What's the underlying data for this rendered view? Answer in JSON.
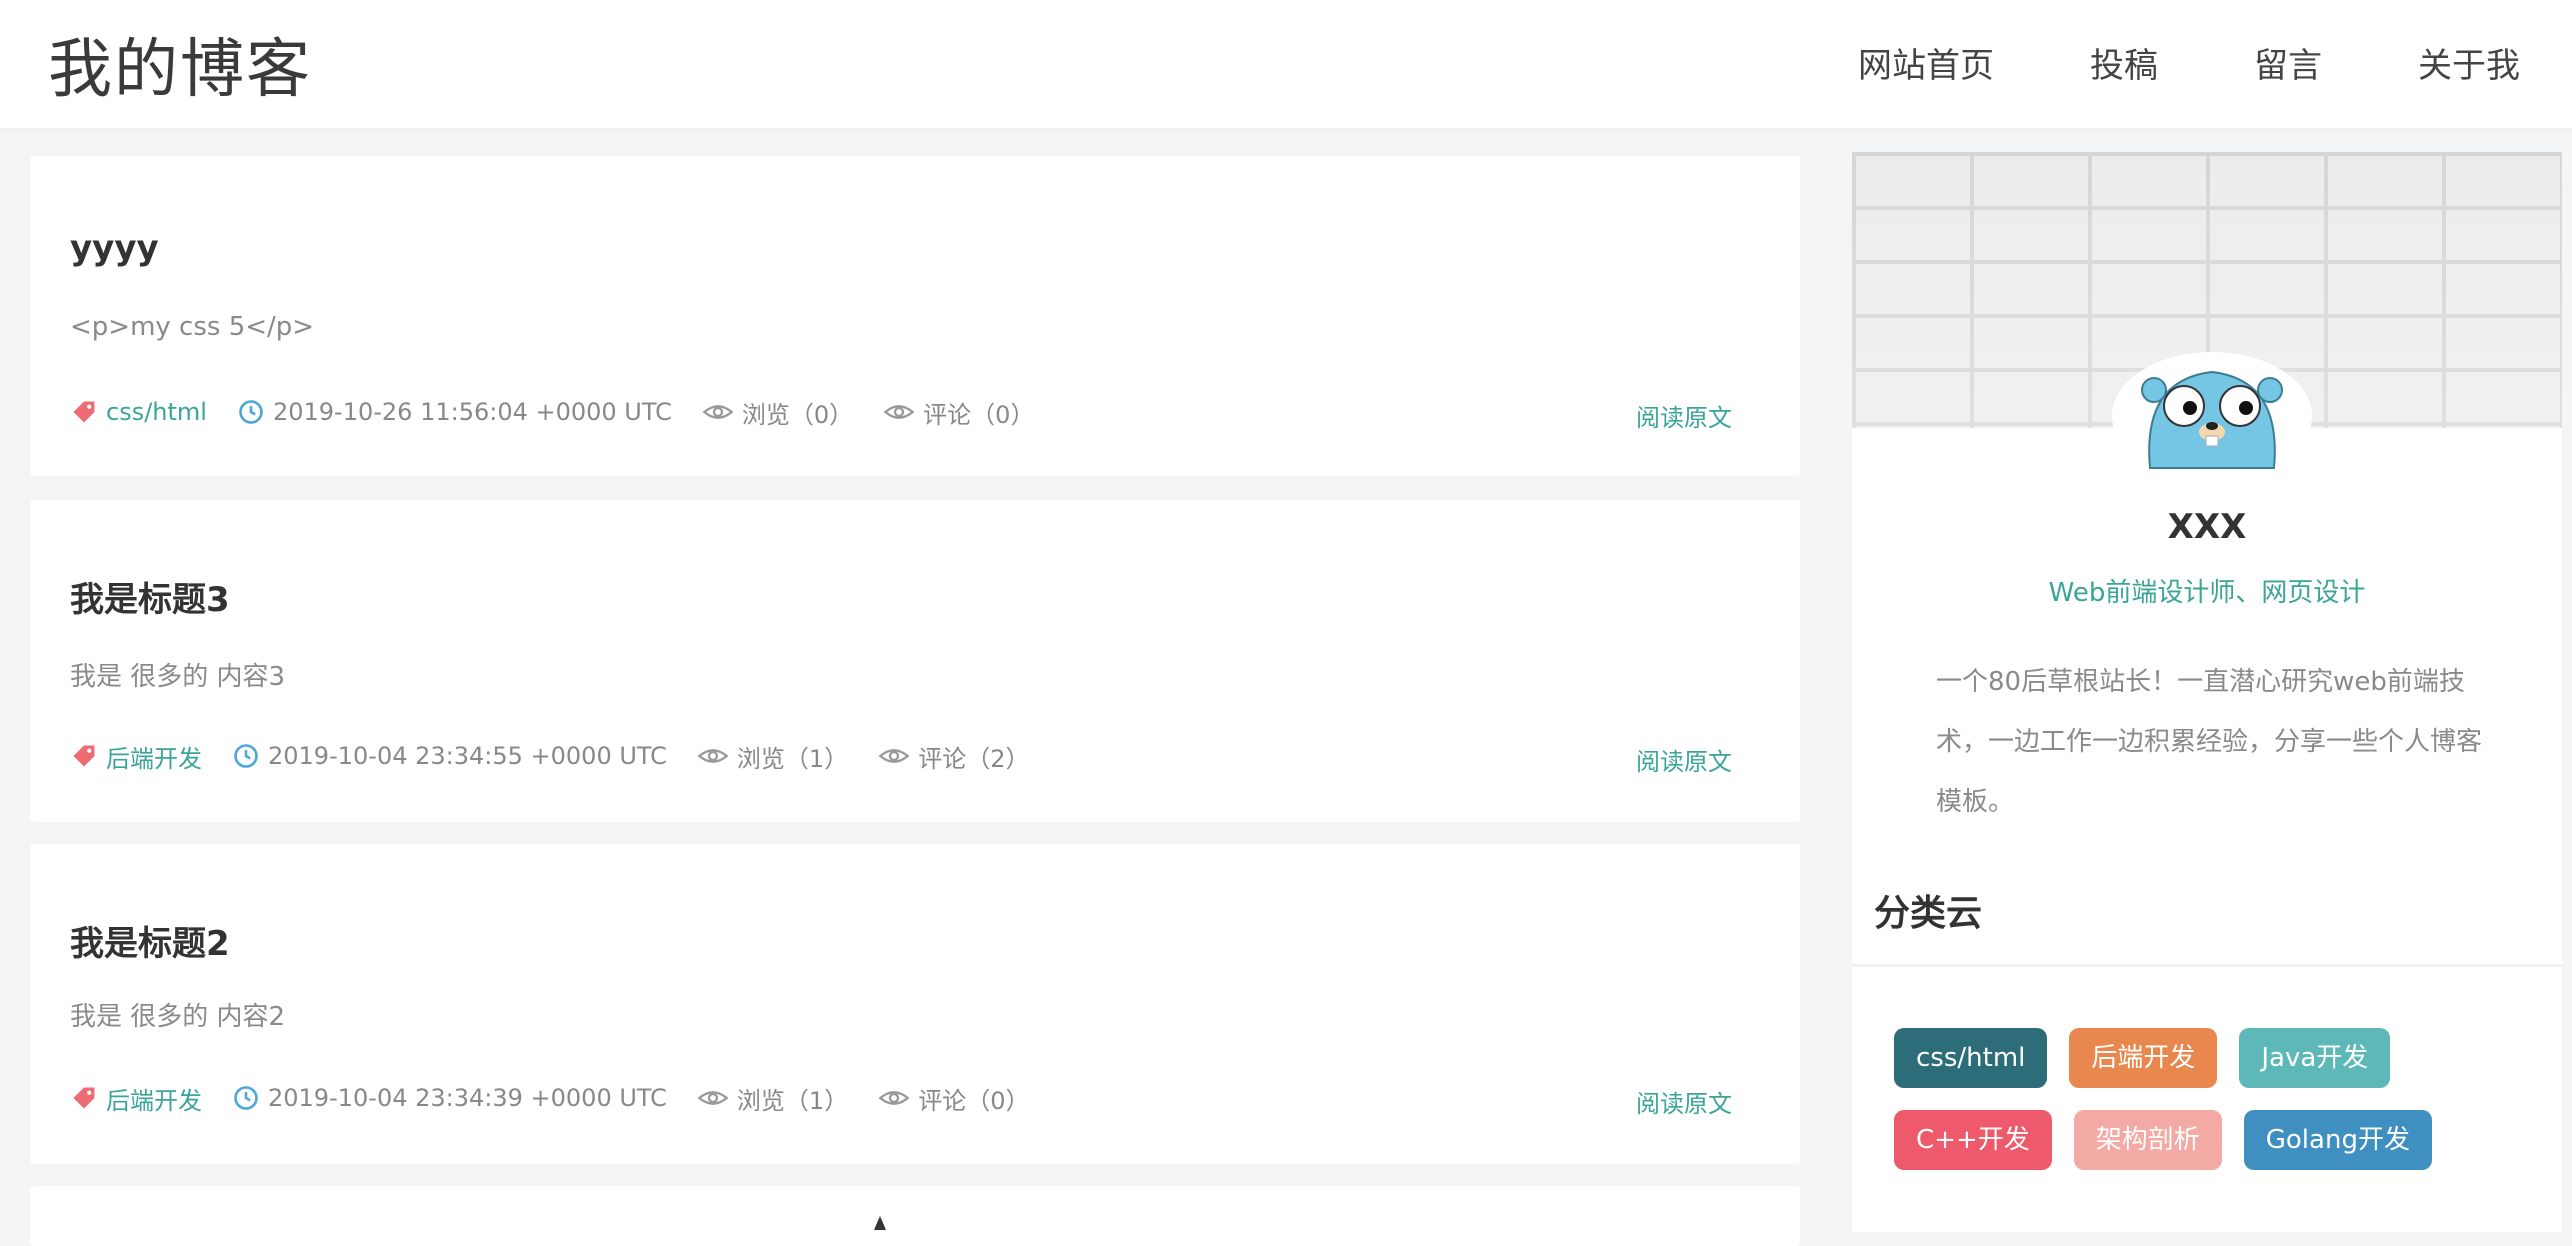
{
  "site": {
    "title": "我的博客"
  },
  "nav": [
    "网站首页",
    "投稿",
    "留言",
    "关于我"
  ],
  "posts": [
    {
      "title": "yyyy",
      "summary": "<p>my css 5</p>",
      "category": "css/html",
      "date": "2019-10-26 11:56:04 +0000 UTC",
      "views": "浏览（0）",
      "comments": "评论（0）",
      "read_more": "阅读原文"
    },
    {
      "title": "我是标题3",
      "summary": "我是 很多的 内容3",
      "category": "后端开发",
      "date": "2019-10-04 23:34:55 +0000 UTC",
      "views": "浏览（1）",
      "comments": "评论（2）",
      "read_more": "阅读原文"
    },
    {
      "title": "我是标题2",
      "summary": "我是 很多的 内容2",
      "category": "后端开发",
      "date": "2019-10-04 23:34:39 +0000 UTC",
      "views": "浏览（1）",
      "comments": "评论（0）",
      "read_more": "阅读原文"
    }
  ],
  "profile": {
    "name": "XXX",
    "role": "Web前端设计师、网页设计",
    "bio": "一个80后草根站长！一直潜心研究web前端技术，一边工作一边积累经验，分享一些个人博客模板。"
  },
  "categories": {
    "title": "分类云",
    "tags": [
      {
        "label": "css/html",
        "color": "#2d6d7a"
      },
      {
        "label": "后端开发",
        "color": "#e8884e"
      },
      {
        "label": "Java开发",
        "color": "#5fb8b8"
      },
      {
        "label": "C++开发",
        "color": "#ee5a6b"
      },
      {
        "label": "架构剖析",
        "color": "#f3a9a4"
      },
      {
        "label": "Golang开发",
        "color": "#3f8fc0"
      }
    ]
  },
  "colors": {
    "accent": "#3aa596",
    "tag_icon": "#ee6b74",
    "clock_icon": "#4aa7d8"
  }
}
